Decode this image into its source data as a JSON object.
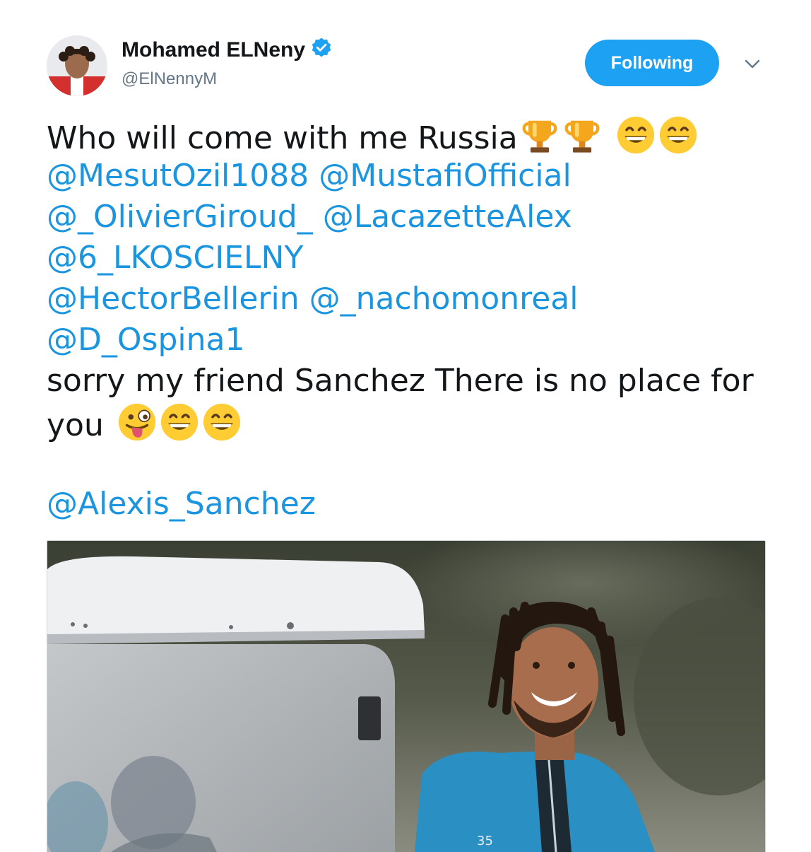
{
  "author": {
    "name": "Mohamed ELNeny",
    "handle": "@ElNennyM",
    "verified": true,
    "avatar_icon": "user-avatar-photo"
  },
  "follow_button": {
    "label": "Following"
  },
  "menu": {
    "icon": "chevron-down-icon"
  },
  "tweet": {
    "line1_text": "Who will come with me Russia",
    "line1_emojis": [
      "trophy",
      "trophy",
      "grinning-face",
      "grinning-face"
    ],
    "mentions_row1": [
      "@MesutOzil1088",
      "@MustafiOfficial"
    ],
    "mentions_row2": [
      "@_OlivierGiroud_",
      "@LacazetteAlex"
    ],
    "mentions_row3": [
      "@6_LKOSCIELNY"
    ],
    "mentions_row4": [
      "@HectorBellerin",
      "@_nachomonreal"
    ],
    "mentions_row5": [
      "@D_Ospina1"
    ],
    "line_sorry": "sorry my friend Sanchez There is no place for",
    "line_you": "you",
    "you_emojis": [
      "winking-face-with-tongue",
      "grinning-face",
      "grinning-face"
    ],
    "final_mention": "@Alexis_Sanchez"
  },
  "media": {
    "alt_description": "photo-icon"
  },
  "colors": {
    "link": "#1b95e0",
    "button": "#1da1f2",
    "secondary": "#657786",
    "text": "#14171a"
  }
}
